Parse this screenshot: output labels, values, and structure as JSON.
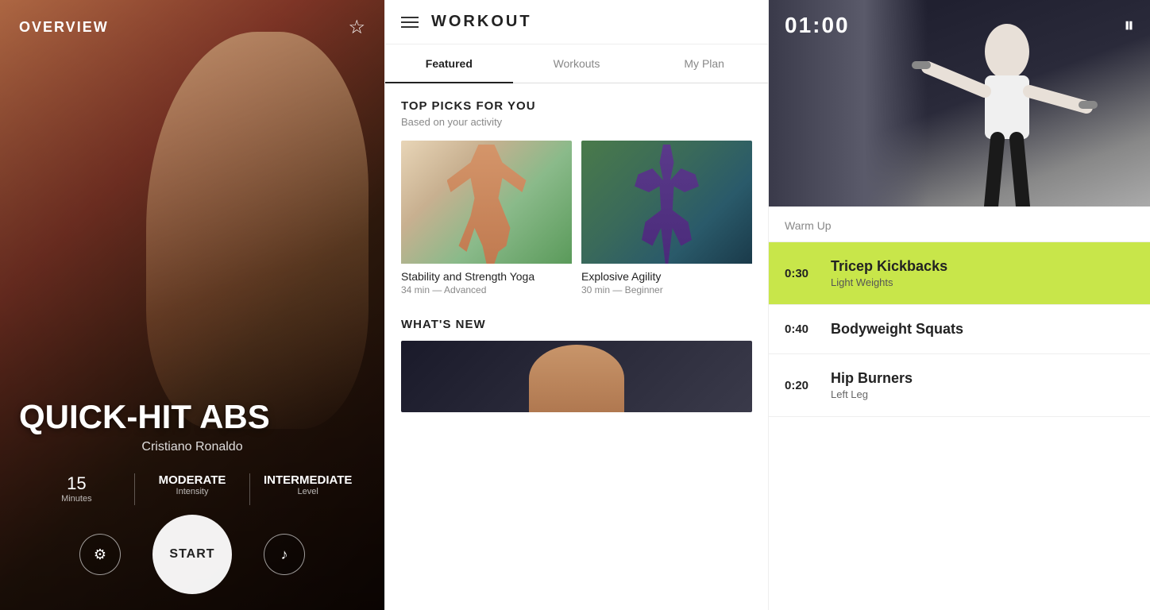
{
  "overview": {
    "title": "OVERVIEW",
    "workout_name": "QUICK-HIT ABS",
    "trainer": "Cristiano Ronaldo",
    "stats": [
      {
        "value": "15",
        "label": "Minutes"
      },
      {
        "value": "MODERATE",
        "label": "Intensity"
      },
      {
        "value": "INTERMEDIATE",
        "label": "Level"
      }
    ],
    "start_label": "START",
    "settings_icon": "⚙",
    "music_icon": "♪",
    "star_icon": "☆"
  },
  "workout": {
    "header_title": "WORKOUT",
    "tabs": [
      {
        "id": "featured",
        "label": "Featured",
        "active": true
      },
      {
        "id": "workouts",
        "label": "Workouts",
        "active": false
      },
      {
        "id": "my-plan",
        "label": "My Plan",
        "active": false
      }
    ],
    "top_picks": {
      "title": "TOP PICKS FOR YOU",
      "subtitle": "Based on your activity"
    },
    "cards": [
      {
        "name": "Stability and Strength Yoga",
        "meta": "34 min — Advanced",
        "type": "yoga"
      },
      {
        "name": "Explosive Agility",
        "meta": "30 min — Beginner",
        "type": "agility"
      }
    ],
    "what_new_title": "WHAT'S NEW"
  },
  "player": {
    "timer": "01:00",
    "pause_icon": "⏸",
    "warm_up_label": "Warm Up",
    "exercises": [
      {
        "time": "0:30",
        "name": "Tricep Kickbacks",
        "detail": "Light Weights",
        "active": true
      },
      {
        "time": "0:40",
        "name": "Bodyweight Squats",
        "detail": "",
        "active": false
      },
      {
        "time": "0:20",
        "name": "Hip Burners",
        "detail": "Left Leg",
        "active": false
      }
    ]
  }
}
